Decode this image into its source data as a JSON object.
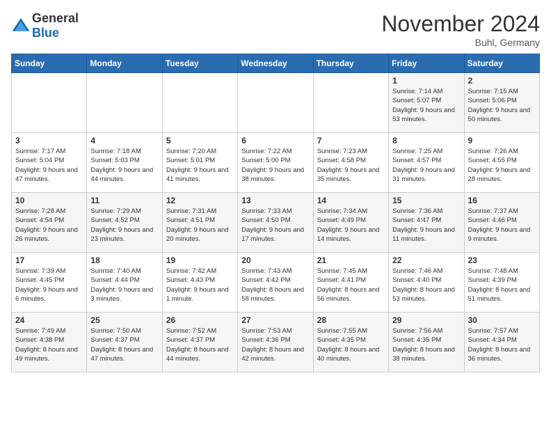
{
  "logo": {
    "text_general": "General",
    "text_blue": "Blue"
  },
  "header": {
    "month": "November 2024",
    "location": "Buhl, Germany"
  },
  "days_of_week": [
    "Sunday",
    "Monday",
    "Tuesday",
    "Wednesday",
    "Thursday",
    "Friday",
    "Saturday"
  ],
  "weeks": [
    [
      {
        "day": "",
        "info": ""
      },
      {
        "day": "",
        "info": ""
      },
      {
        "day": "",
        "info": ""
      },
      {
        "day": "",
        "info": ""
      },
      {
        "day": "",
        "info": ""
      },
      {
        "day": "1",
        "info": "Sunrise: 7:14 AM\nSunset: 5:07 PM\nDaylight: 9 hours and 53 minutes."
      },
      {
        "day": "2",
        "info": "Sunrise: 7:15 AM\nSunset: 5:06 PM\nDaylight: 9 hours and 50 minutes."
      }
    ],
    [
      {
        "day": "3",
        "info": "Sunrise: 7:17 AM\nSunset: 5:04 PM\nDaylight: 9 hours and 47 minutes."
      },
      {
        "day": "4",
        "info": "Sunrise: 7:18 AM\nSunset: 5:03 PM\nDaylight: 9 hours and 44 minutes."
      },
      {
        "day": "5",
        "info": "Sunrise: 7:20 AM\nSunset: 5:01 PM\nDaylight: 9 hours and 41 minutes."
      },
      {
        "day": "6",
        "info": "Sunrise: 7:22 AM\nSunset: 5:00 PM\nDaylight: 9 hours and 38 minutes."
      },
      {
        "day": "7",
        "info": "Sunrise: 7:23 AM\nSunset: 4:58 PM\nDaylight: 9 hours and 35 minutes."
      },
      {
        "day": "8",
        "info": "Sunrise: 7:25 AM\nSunset: 4:57 PM\nDaylight: 9 hours and 31 minutes."
      },
      {
        "day": "9",
        "info": "Sunrise: 7:26 AM\nSunset: 4:55 PM\nDaylight: 9 hours and 28 minutes."
      }
    ],
    [
      {
        "day": "10",
        "info": "Sunrise: 7:28 AM\nSunset: 4:54 PM\nDaylight: 9 hours and 26 minutes."
      },
      {
        "day": "11",
        "info": "Sunrise: 7:29 AM\nSunset: 4:52 PM\nDaylight: 9 hours and 23 minutes."
      },
      {
        "day": "12",
        "info": "Sunrise: 7:31 AM\nSunset: 4:51 PM\nDaylight: 9 hours and 20 minutes."
      },
      {
        "day": "13",
        "info": "Sunrise: 7:33 AM\nSunset: 4:50 PM\nDaylight: 9 hours and 17 minutes."
      },
      {
        "day": "14",
        "info": "Sunrise: 7:34 AM\nSunset: 4:49 PM\nDaylight: 9 hours and 14 minutes."
      },
      {
        "day": "15",
        "info": "Sunrise: 7:36 AM\nSunset: 4:47 PM\nDaylight: 9 hours and 11 minutes."
      },
      {
        "day": "16",
        "info": "Sunrise: 7:37 AM\nSunset: 4:46 PM\nDaylight: 9 hours and 9 minutes."
      }
    ],
    [
      {
        "day": "17",
        "info": "Sunrise: 7:39 AM\nSunset: 4:45 PM\nDaylight: 9 hours and 6 minutes."
      },
      {
        "day": "18",
        "info": "Sunrise: 7:40 AM\nSunset: 4:44 PM\nDaylight: 9 hours and 3 minutes."
      },
      {
        "day": "19",
        "info": "Sunrise: 7:42 AM\nSunset: 4:43 PM\nDaylight: 9 hours and 1 minute."
      },
      {
        "day": "20",
        "info": "Sunrise: 7:43 AM\nSunset: 4:42 PM\nDaylight: 8 hours and 58 minutes."
      },
      {
        "day": "21",
        "info": "Sunrise: 7:45 AM\nSunset: 4:41 PM\nDaylight: 8 hours and 56 minutes."
      },
      {
        "day": "22",
        "info": "Sunrise: 7:46 AM\nSunset: 4:40 PM\nDaylight: 8 hours and 53 minutes."
      },
      {
        "day": "23",
        "info": "Sunrise: 7:48 AM\nSunset: 4:39 PM\nDaylight: 8 hours and 51 minutes."
      }
    ],
    [
      {
        "day": "24",
        "info": "Sunrise: 7:49 AM\nSunset: 4:38 PM\nDaylight: 8 hours and 49 minutes."
      },
      {
        "day": "25",
        "info": "Sunrise: 7:50 AM\nSunset: 4:37 PM\nDaylight: 8 hours and 47 minutes."
      },
      {
        "day": "26",
        "info": "Sunrise: 7:52 AM\nSunset: 4:37 PM\nDaylight: 8 hours and 44 minutes."
      },
      {
        "day": "27",
        "info": "Sunrise: 7:53 AM\nSunset: 4:36 PM\nDaylight: 8 hours and 42 minutes."
      },
      {
        "day": "28",
        "info": "Sunrise: 7:55 AM\nSunset: 4:35 PM\nDaylight: 8 hours and 40 minutes."
      },
      {
        "day": "29",
        "info": "Sunrise: 7:56 AM\nSunset: 4:35 PM\nDaylight: 8 hours and 38 minutes."
      },
      {
        "day": "30",
        "info": "Sunrise: 7:57 AM\nSunset: 4:34 PM\nDaylight: 8 hours and 36 minutes."
      }
    ]
  ]
}
